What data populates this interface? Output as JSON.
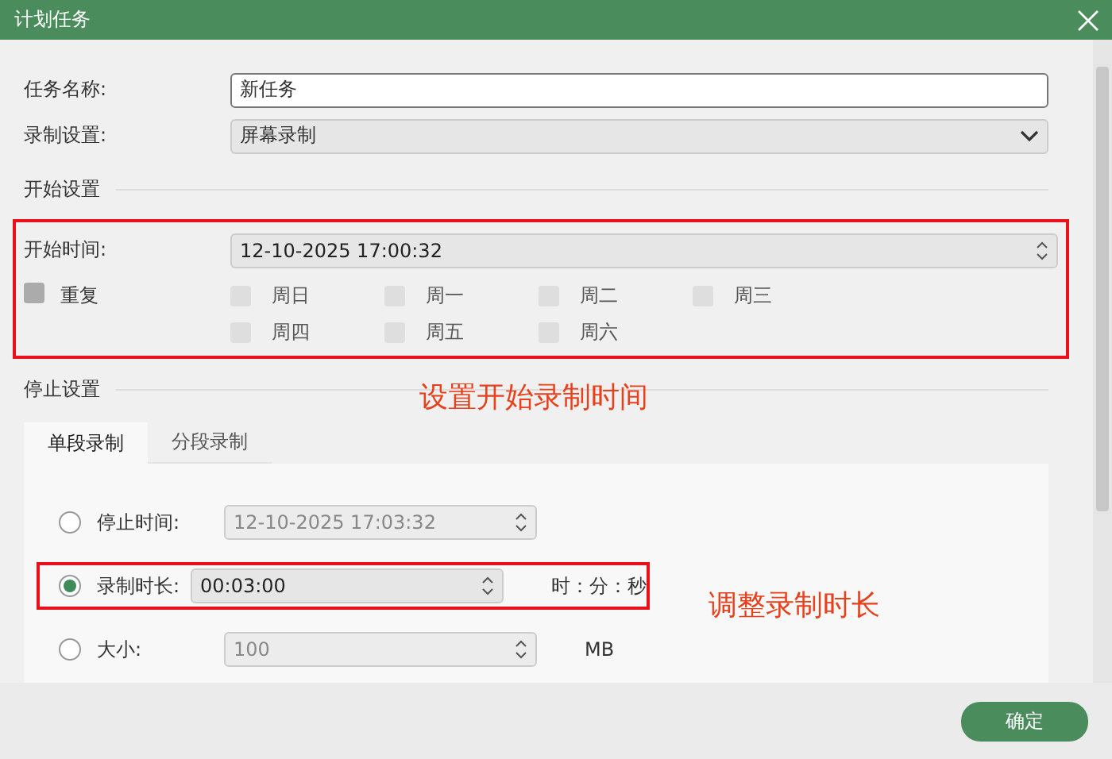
{
  "window": {
    "title": "计划任务"
  },
  "fields": [
    {
      "kind": "text",
      "label": "任务名称:",
      "value": "新任务"
    },
    {
      "kind": "dropdown",
      "label": "录制设置:",
      "value": "屏幕录制"
    }
  ],
  "start_section": {
    "title": "开始设置",
    "start_time": {
      "label": "开始时间:",
      "value": "12-10-2025 17:00:32"
    },
    "repeat": {
      "label": "重复",
      "checked": false
    },
    "days": [
      {
        "label": "周日",
        "checked": false,
        "disabled": true
      },
      {
        "label": "周一",
        "checked": false,
        "disabled": true
      },
      {
        "label": "周二",
        "checked": false,
        "disabled": true
      },
      {
        "label": "周三",
        "checked": false,
        "disabled": true
      },
      {
        "label": "周四",
        "checked": false,
        "disabled": true
      },
      {
        "label": "周五",
        "checked": false,
        "disabled": true
      },
      {
        "label": "周六",
        "checked": false,
        "disabled": true
      }
    ]
  },
  "stop_section": {
    "title": "停止设置",
    "tabs": [
      {
        "label": "单段录制",
        "selected": true
      },
      {
        "label": "分段录制",
        "selected": false
      }
    ],
    "options": [
      {
        "label": "停止时间:",
        "value": "12-10-2025 17:03:32",
        "selected": false,
        "highlighted": false
      },
      {
        "label": "录制时长:",
        "value": "00:03:00",
        "unit": "时：分：秒",
        "selected": true,
        "highlighted": true
      },
      {
        "label": "大小:",
        "value": "100",
        "unit": "MB",
        "selected": false,
        "highlighted": false
      }
    ]
  },
  "annotations": [
    "设置开始录制时间",
    "调整录制时长"
  ],
  "buttons": [
    "确定"
  ]
}
